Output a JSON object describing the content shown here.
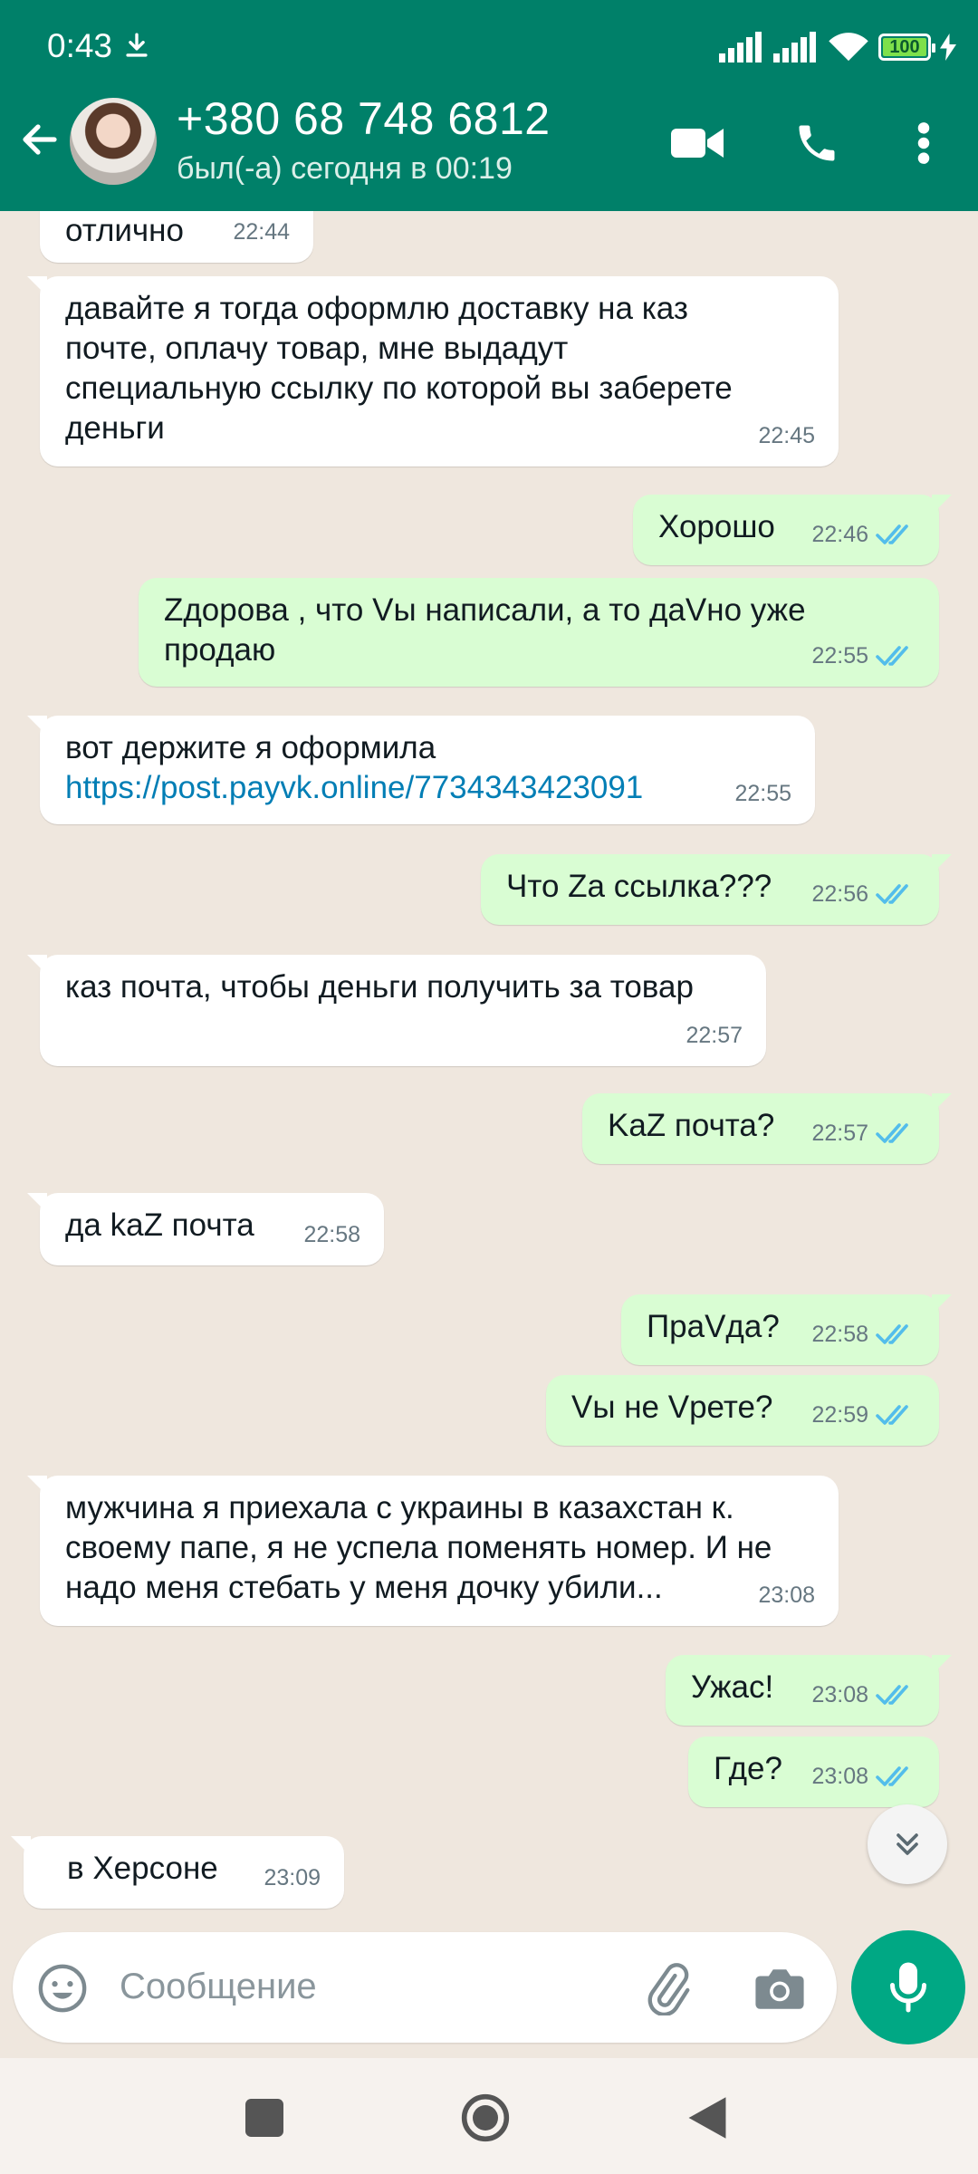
{
  "status_bar": {
    "time": "0:43",
    "battery": "100"
  },
  "header": {
    "contact_name": "+380 68 748 6812",
    "contact_status": "был(-а) сегодня в 00:19"
  },
  "messages": [
    {
      "dir": "in",
      "text": "отлично",
      "time": "22:44"
    },
    {
      "dir": "in",
      "text": "давайте я тогда оформлю доставку на каз почте, оплачу товар, мне выдадут специальную ссылку по которой вы заберете деньги",
      "time": "22:45"
    },
    {
      "dir": "out",
      "text": "Хорошо",
      "time": "22:46"
    },
    {
      "dir": "out",
      "text": "Zдорова , что Vы написали, а то даVно уже продаю",
      "time": "22:55"
    },
    {
      "dir": "in",
      "text": "вот держите я оформила",
      "link": "https://post.payvk.online/7734343423091",
      "time": "22:55"
    },
    {
      "dir": "out",
      "text": "Что Zа ссылка???",
      "time": "22:56"
    },
    {
      "dir": "in",
      "text": "каз почта, чтобы деньги получить за товар",
      "time": "22:57"
    },
    {
      "dir": "out",
      "text": "KaZ почта?",
      "time": "22:57"
    },
    {
      "dir": "in",
      "text": "да kaZ почта",
      "time": "22:58"
    },
    {
      "dir": "out",
      "text": "ПраVда?",
      "time": "22:58"
    },
    {
      "dir": "out",
      "text": "Vы не Vрете?",
      "time": "22:59"
    },
    {
      "dir": "in",
      "text": "мужчина я приехала с украины в казахстан к. своему папе, я не успела поменять номер. И не надо меня стебать у меня дочку убили...",
      "time": "23:08"
    },
    {
      "dir": "out",
      "text": "Ужас!",
      "time": "23:08"
    },
    {
      "dir": "out",
      "text": "Где?",
      "time": "23:08"
    },
    {
      "dir": "in",
      "text": "в Херсоне",
      "time": "23:09"
    }
  ],
  "composer": {
    "placeholder": "Сообщение"
  },
  "colors": {
    "header": "#008069",
    "outgoing": "#d9fdd3",
    "incoming": "#ffffff",
    "accent": "#00a884",
    "read_ticks": "#53bdeb"
  },
  "icons": [
    "back-arrow-icon",
    "video-call-icon",
    "phone-icon",
    "more-vert-icon",
    "emoji-icon",
    "attach-icon",
    "camera-icon",
    "mic-icon",
    "double-check-icon",
    "chevron-double-down-icon"
  ]
}
